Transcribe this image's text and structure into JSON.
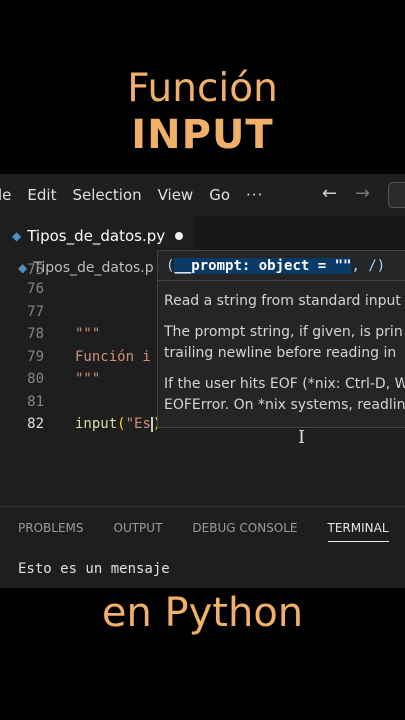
{
  "overlay": {
    "title_line1": "Función",
    "title_line2": "INPUT",
    "bottom_text": "en Python"
  },
  "menubar": {
    "items": [
      "le",
      "Edit",
      "Selection",
      "View",
      "Go",
      "···"
    ],
    "back_icon": "arrow-left-icon",
    "forward_icon": "arrow-right-icon"
  },
  "tab": {
    "filename": "Tipos_de_datos.py",
    "modified": true
  },
  "breadcrumb": {
    "file": "Tipos_de_datos.p"
  },
  "editor": {
    "line_numbers": [
      "75",
      "76",
      "77",
      "78",
      "79",
      "80",
      "81",
      "82"
    ],
    "active_line": "82",
    "lines": [
      "",
      "",
      "",
      "\"\"\"",
      "Función i",
      "\"\"\"",
      "",
      ""
    ],
    "line82_fn": "input",
    "line82_open": "(",
    "line82_string": "\"Es",
    "line82_close": ")"
  },
  "hover": {
    "signature_prefix": "(",
    "signature_param": "__prompt: object = \"\"",
    "signature_suffix": ", /)",
    "para1": "Read a string from standard input",
    "para2_line1": "The prompt string, if given, is prin",
    "para2_line2": "trailing newline before reading in",
    "para3_line1": "If the user hits EOF (*nix: Ctrl-D, W",
    "para3_line2": "EOFError. On *nix systems, readlin"
  },
  "panel": {
    "tabs": [
      "PROBLEMS",
      "OUTPUT",
      "DEBUG CONSOLE",
      "TERMINAL"
    ],
    "active_tab": "TERMINAL",
    "terminal_output": "Esto es un mensaje"
  },
  "colors": {
    "accent_text": "#f0b06a",
    "editor_bg": "#1e1e1e",
    "string": "#ce9178",
    "function": "#dcdcaa"
  }
}
